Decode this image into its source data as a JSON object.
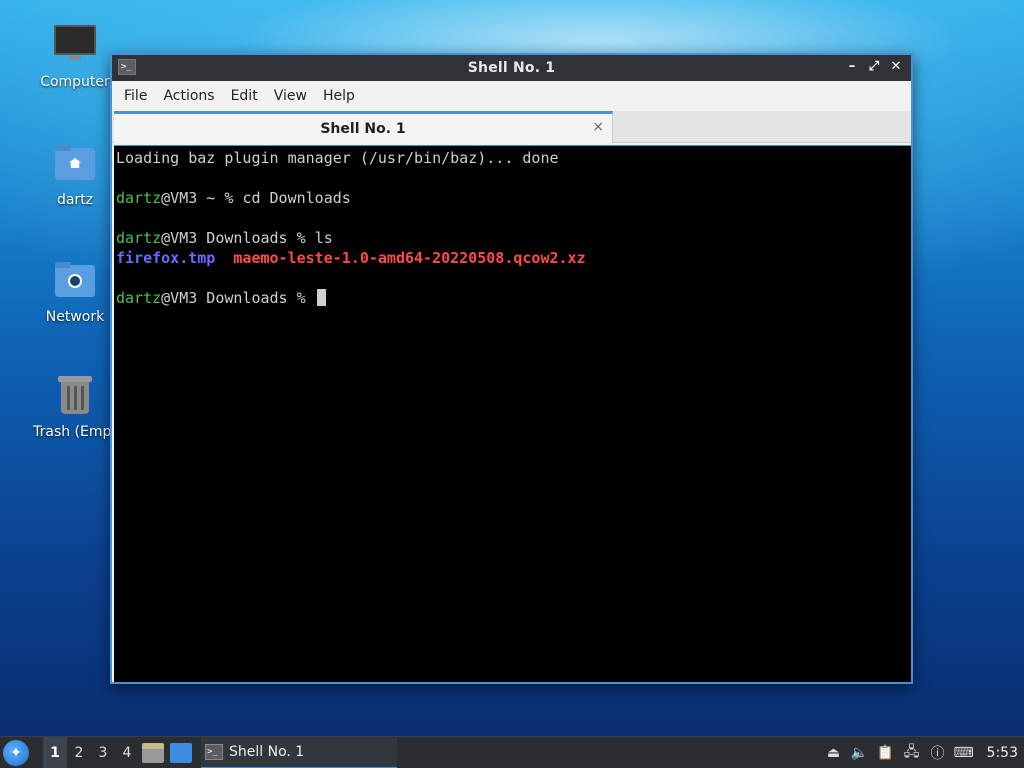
{
  "desktop": {
    "icons": [
      {
        "label": "Computer"
      },
      {
        "label": "dartz"
      },
      {
        "label": "Network"
      },
      {
        "label": "Trash (Empt"
      }
    ]
  },
  "window": {
    "title": "Shell No. 1",
    "menu": [
      "File",
      "Actions",
      "Edit",
      "View",
      "Help"
    ],
    "tab": {
      "label": "Shell No. 1",
      "close": "×"
    }
  },
  "terminal": {
    "line1": "Loading baz plugin manager (/usr/bin/baz)... done",
    "prompt_user": "dartz",
    "prompt_host_home": "@VM3 ~ % ",
    "cmd1": "cd Downloads",
    "prompt_host_dl": "@VM3 Downloads % ",
    "cmd2": "ls",
    "file1": "firefox.tmp",
    "file2": "maemo-leste-1.0-amd64-20220508.qcow2.xz"
  },
  "taskbar": {
    "workspaces": [
      "1",
      "2",
      "3",
      "4"
    ],
    "task_label": "Shell No. 1",
    "clock": "5:53"
  },
  "colors": {
    "accent": "#4a90d9",
    "prompt_green": "#4ec04e",
    "file_blue": "#6a6aff",
    "file_red": "#ff4a4a"
  }
}
